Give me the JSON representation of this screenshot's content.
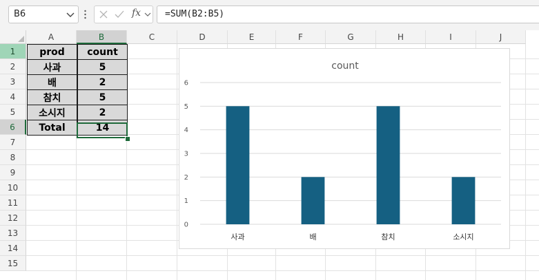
{
  "formula_bar": {
    "name_box": "B6",
    "function_icon": "fx",
    "formula": "=SUM(B2:B5)"
  },
  "columns": [
    "A",
    "B",
    "C",
    "D",
    "E",
    "F",
    "G",
    "H",
    "I",
    "J"
  ],
  "rows": [
    "1",
    "2",
    "3",
    "4",
    "5",
    "6",
    "7",
    "8",
    "9",
    "10",
    "11",
    "12",
    "13",
    "14",
    "15"
  ],
  "table": {
    "header": [
      "prod",
      "count"
    ],
    "rows": [
      [
        "사과",
        "5"
      ],
      [
        "배",
        "2"
      ],
      [
        "참치",
        "5"
      ],
      [
        "소시지",
        "2"
      ],
      [
        "Total",
        "14"
      ]
    ]
  },
  "colors": {
    "bar": "#156082",
    "selection": "#1e6a3a",
    "cell_fill": "#d9d9d9"
  },
  "chart_data": {
    "type": "bar",
    "title": "count",
    "categories": [
      "사과",
      "배",
      "참치",
      "소시지"
    ],
    "values": [
      5,
      2,
      5,
      2
    ],
    "ylim": [
      0,
      6
    ],
    "yticks": [
      "0",
      "1",
      "2",
      "3",
      "4",
      "5",
      "6"
    ],
    "grid": true,
    "legend": "none"
  }
}
